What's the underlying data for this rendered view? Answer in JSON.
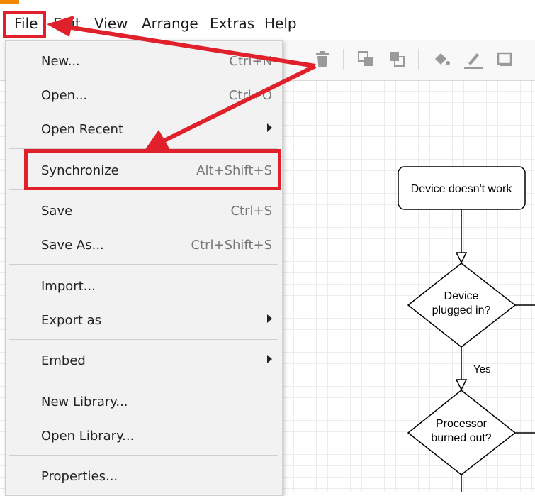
{
  "menubar": {
    "items": [
      "File",
      "Edit",
      "View",
      "Arrange",
      "Extras",
      "Help"
    ]
  },
  "file_menu": {
    "new": {
      "label": "New...",
      "shortcut": "Ctrl+N"
    },
    "open": {
      "label": "Open...",
      "shortcut": "Ctrl+O"
    },
    "open_recent": {
      "label": "Open Recent"
    },
    "synchronize": {
      "label": "Synchronize",
      "shortcut": "Alt+Shift+S"
    },
    "save": {
      "label": "Save",
      "shortcut": "Ctrl+S"
    },
    "save_as": {
      "label": "Save As...",
      "shortcut": "Ctrl+Shift+S"
    },
    "import": {
      "label": "Import..."
    },
    "export_as": {
      "label": "Export as"
    },
    "embed": {
      "label": "Embed"
    },
    "new_library": {
      "label": "New Library..."
    },
    "open_library": {
      "label": "Open Library..."
    },
    "properties": {
      "label": "Properties..."
    }
  },
  "toolbar": {
    "icons": [
      "delete-icon",
      "to-front-icon",
      "to-back-icon",
      "fill-color-icon",
      "line-color-icon",
      "shadow-icon"
    ]
  },
  "diagram": {
    "start_node": "Device doesn't work",
    "decision1": [
      "Device",
      "plugged in?"
    ],
    "edge_yes": "Yes",
    "decision2": [
      "Processor",
      "burned out?"
    ]
  },
  "colors": {
    "highlight": "#e0202a",
    "brand": "#f08705"
  }
}
